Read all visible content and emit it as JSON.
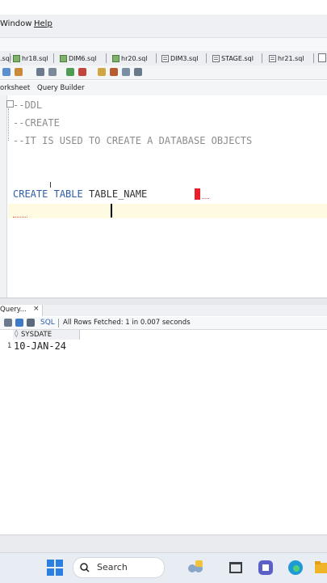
{
  "menubar": {
    "window": "Window",
    "help": "Help"
  },
  "file_tabs": [
    {
      "label": ".sql"
    },
    {
      "label": "hr18.sql"
    },
    {
      "label": "DIM6.sql"
    },
    {
      "label": "hr20.sql"
    },
    {
      "label": "DIM3.sql"
    },
    {
      "label": "STAGE.sql"
    },
    {
      "label": "hr21.sql"
    }
  ],
  "subtabs": {
    "worksheet": "orksheet",
    "query_builder": "Query Builder"
  },
  "editor": {
    "lines": {
      "l1": "--DDL",
      "l2": "--CREATE",
      "l3": "--IT IS USED TO CREATE A DATABASE OBJECTS",
      "l5_kw1": "CREATE",
      "l5_kw2": "TABLE",
      "l5_id": "TABLE_NAME"
    }
  },
  "query_panel": {
    "tab_label": "Query...",
    "close_glyph": "×",
    "sql_label": "SQL",
    "fetch_status": "All Rows Fetched: 1 in 0.007 seconds",
    "column_header": "SYSDATE",
    "row_number": "1",
    "row_value": "10-JAN-24"
  },
  "taskbar": {
    "search_label": "Search"
  },
  "colors": {
    "keyword": "#2f5fa8",
    "comment": "#8c8c8c",
    "accent_red": "#e8202a",
    "current_line": "#fffbe3"
  }
}
